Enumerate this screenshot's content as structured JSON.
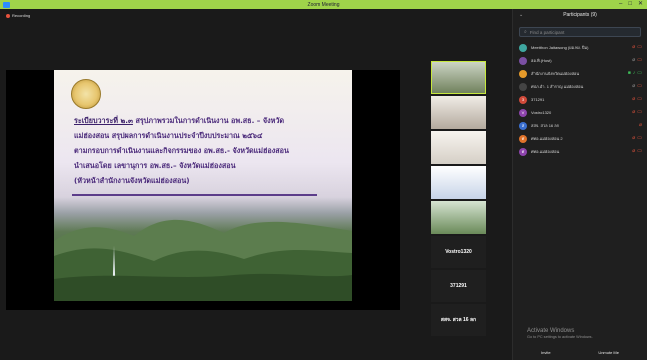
{
  "window": {
    "title": "Zoom Meeting",
    "minimize": "–",
    "maximize": "□",
    "close": "✕"
  },
  "recording": {
    "label": "Recording"
  },
  "slide": {
    "line1a": "ระเบียบวาระที่ ๒.๓",
    "line1b": " สรุปภาพรวมในการดำเนินงาน อพ.สธ. – จังหวัด",
    "line2": "แม่ฮ่องสอน สรุปผลการดำเนินงานประจำปีงบประมาณ ๒๕๖๔",
    "line3": "ตามกรอบการดำเนินงานและกิจกรรมของ อพ.สธ.- จังหวัดแม่ฮ่องสอน",
    "line4": "นำเสนอโดย เลขานุการ อพ.สธ.– จังหวัดแม่ฮ่องสอน",
    "line5": "(หัวหน้าสำนักงานจังหวัดแม่ฮ่องสอน)"
  },
  "gallery": {
    "names": [
      "Vostro1320",
      "371291",
      "สสจ. สวล 16 ลก"
    ]
  },
  "participants": {
    "title": "Participants (9)",
    "collapse_icon": "⌄",
    "search_placeholder": "Find a participant",
    "list": [
      {
        "name": "Meetthon Jaitawong (ผอ.พง. ปีม)",
        "initial": "",
        "color": "#3fa7a0",
        "mic": "muted",
        "cam": "off"
      },
      {
        "name": "ฮอ.พิ.(Host)",
        "initial": "",
        "color": "#7a4fa3",
        "mic": "off-grey",
        "cam": "off"
      },
      {
        "name": "สำนักงานจังหวัดแม่ฮ่องสอน",
        "initial": "",
        "color": "#e59a2a",
        "mic": "on",
        "cam": "on",
        "share": true
      },
      {
        "name": "ศปภ.อำ. 1 สำราญ แม่ฮ่องสอน",
        "initial": "",
        "color": "#444",
        "mic": "off-grey",
        "cam": "off"
      },
      {
        "name": "371291",
        "initial": "3",
        "color": "#d04a3a",
        "mic": "muted",
        "cam": "off"
      },
      {
        "name": "Vostro1320",
        "initial": "V",
        "color": "#8e44ad",
        "mic": "muted",
        "cam": "off"
      },
      {
        "name": "สสจ. สวล 16 ลก",
        "initial": "ส",
        "color": "#3a6fd0",
        "mic": "muted",
        "cam": ""
      },
      {
        "name": "ศทอ.แม่ฮ่องสอน 2",
        "initial": "ศ",
        "color": "#e0732b",
        "mic": "muted",
        "cam": "off"
      },
      {
        "name": "ศทอ.แม่ฮ่องสอน",
        "initial": "ศ",
        "color": "#8e44ad",
        "mic": "muted",
        "cam": "off"
      }
    ],
    "activate_title": "Activate Windows",
    "activate_sub": "Go to PC settings to activate Windows.",
    "invite_label": "Invite",
    "unmute_label": "Unmute Me"
  }
}
